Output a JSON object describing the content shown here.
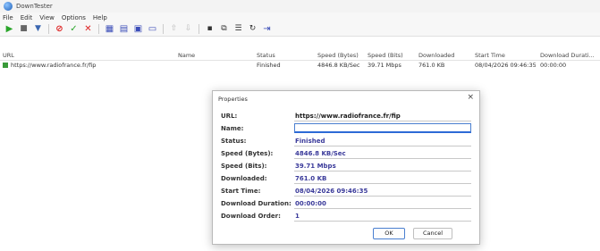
{
  "window": {
    "title": "DownTester"
  },
  "menu": [
    "File",
    "Edit",
    "View",
    "Options",
    "Help"
  ],
  "toolbar_icons": [
    "start-icon",
    "stop-icon",
    "filter-icon",
    "delete-icon",
    "check-icon",
    "remove-icon",
    "window1-icon",
    "window2-icon",
    "window3-icon",
    "window4-icon",
    "up-icon",
    "down-icon",
    "save-icon",
    "copy-icon",
    "properties-icon",
    "refresh-icon",
    "exit-icon"
  ],
  "list": {
    "columns": [
      "URL",
      "Name",
      "Status",
      "Speed (Bytes)",
      "Speed (Bits)",
      "Downloaded",
      "Start Time",
      "Download Durati..."
    ],
    "rows": [
      [
        "https://www.radiofrance.fr/fip",
        "",
        "Finished",
        "4846.8 KB/Sec",
        "39.71 Mbps",
        "761.0 KB",
        "08/04/2026 09:46:35",
        "00:00:00"
      ]
    ]
  },
  "dialog": {
    "title": "Properties",
    "close": "×",
    "labels": {
      "url": "URL:",
      "name": "Name:",
      "status": "Status:",
      "speed_bytes": "Speed (Bytes):",
      "speed_bits": "Speed (Bits):",
      "downloaded": "Downloaded:",
      "start_time": "Start Time:",
      "duration": "Download Duration:",
      "order": "Download Order:"
    },
    "values": {
      "url": "https://www.radiofrance.fr/fip",
      "name": "",
      "status": "Finished",
      "speed_bytes": "4846.8 KB/Sec",
      "speed_bits": "39.71 Mbps",
      "downloaded": "761.0 KB",
      "start_time": "08/04/2026 09:46:35",
      "duration": "00:00:00",
      "order": "1"
    },
    "ok": "OK",
    "cancel": "Cancel"
  }
}
